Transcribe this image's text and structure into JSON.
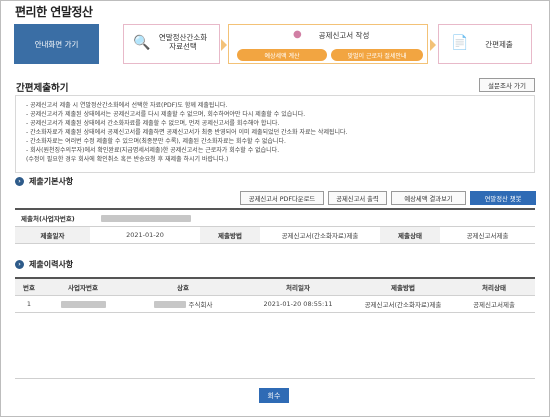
{
  "app_title": "편리한 연말정산",
  "home_button": "안내화면 가기",
  "steps": {
    "step1": "연말정산간소화\n자료선택",
    "step2": "공제신고서 작성",
    "step2_sub1": "예상세액 계산",
    "step2_sub2": "맞벌이 근로자 절세안내",
    "step3": "간편제출"
  },
  "page_title": "간편제출하기",
  "survey_button": "설문조사 가기",
  "notice_lines": [
    "공제신고서 제출 시 연말정산간소화에서 선택한 자료(PDF)도 함께 제출됩니다.",
    "공제신고서가 제출된 상태에서는 공제신고서를 다시 제출할 수 없으며, 회수하여야만 다시 제출할 수 있습니다.",
    "공제신고서가 제출된 상태에서 간소화자료를 제출할 수 없으며, 먼저 공제신고서를 회수해야 합니다.",
    "간소화자료가 제출된 상태에서 공제신고서를 제출하면 공제신고서가 최종 반영되어 이미 제출되었던 간소화 자료는 삭제됩니다.",
    "간소화자료는 여러번 수정 제출할 수 있으며(최종분만 수록), 제출된 간소화자료는 회수할 수 없습니다.",
    "회사(원천징수의무자)에서 확인완료(지급명세서제출)한 공제신고서는 근로자가 회수할 수 없습니다.",
    "(수정이 필요한 경우 회사에 확인취소 혹은 반송요청 후 재제출 하시기 바랍니다.)"
  ],
  "basic_section": {
    "title": "제출기본사항",
    "buttons": [
      "공제신고서 PDF다운로드",
      "공제신고서 출력",
      "예상세액 결과보기",
      "연말정산 챗봇"
    ],
    "submitter_label": "제출처(사업자번호)",
    "date_label": "제출일자",
    "date_value": "2021-01-20",
    "method_label": "제출방법",
    "method_value": "공제신고서(간소화자료)제출",
    "status_label": "제출상태",
    "status_value": "공제신고서제출"
  },
  "history_section": {
    "title": "제출이력사항",
    "columns": [
      "번호",
      "사업자번호",
      "상호",
      "처리일자",
      "제출방법",
      "처리상태"
    ],
    "rows": [
      {
        "no": "1",
        "biz_no": "",
        "name_suffix": "주식회사",
        "processed_at": "2021-01-20 08:55:11",
        "method": "공제신고서(간소화자료)제출",
        "status": "공제신고서제출"
      }
    ]
  },
  "close_button": "회수",
  "colors": {
    "primary": "#2f6bb5",
    "home": "#3a6ea5",
    "pill": "#f2a541"
  }
}
